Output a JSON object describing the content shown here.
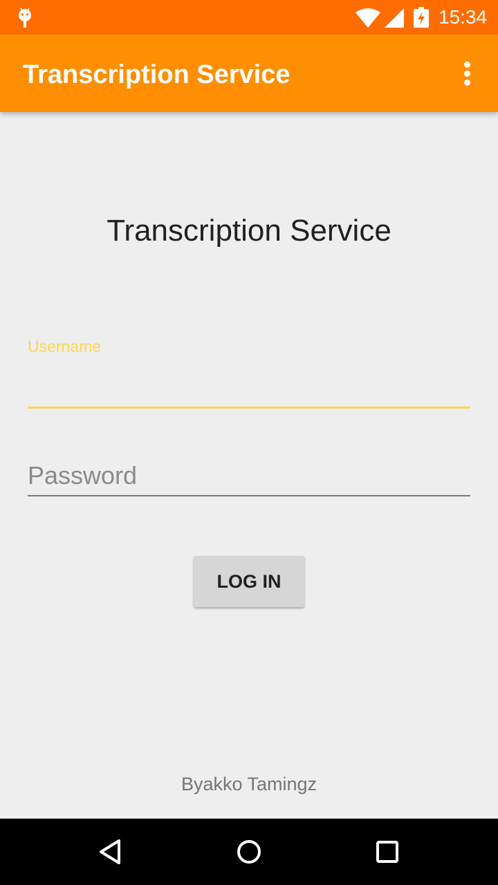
{
  "status_bar": {
    "time": "15:34",
    "icons": [
      "android-icon",
      "wifi-icon",
      "signal-icon",
      "battery-charging-icon"
    ]
  },
  "app_bar": {
    "title": "Transcription Service",
    "menu_icon": "more-vert-icon"
  },
  "login_form": {
    "heading": "Transcription Service",
    "username_label": "Username",
    "username_value": "",
    "password_placeholder": "Password",
    "password_value": "",
    "login_label": "LOG IN"
  },
  "footer": {
    "credit": "Byakko Tamingz"
  },
  "nav_bar": {
    "icons": [
      "back-icon",
      "home-icon",
      "recents-icon"
    ]
  },
  "colors": {
    "status_bar": "#ff6d00",
    "app_bar": "#ff8f00",
    "accent": "#ffd54f",
    "background": "#eeeeee"
  }
}
